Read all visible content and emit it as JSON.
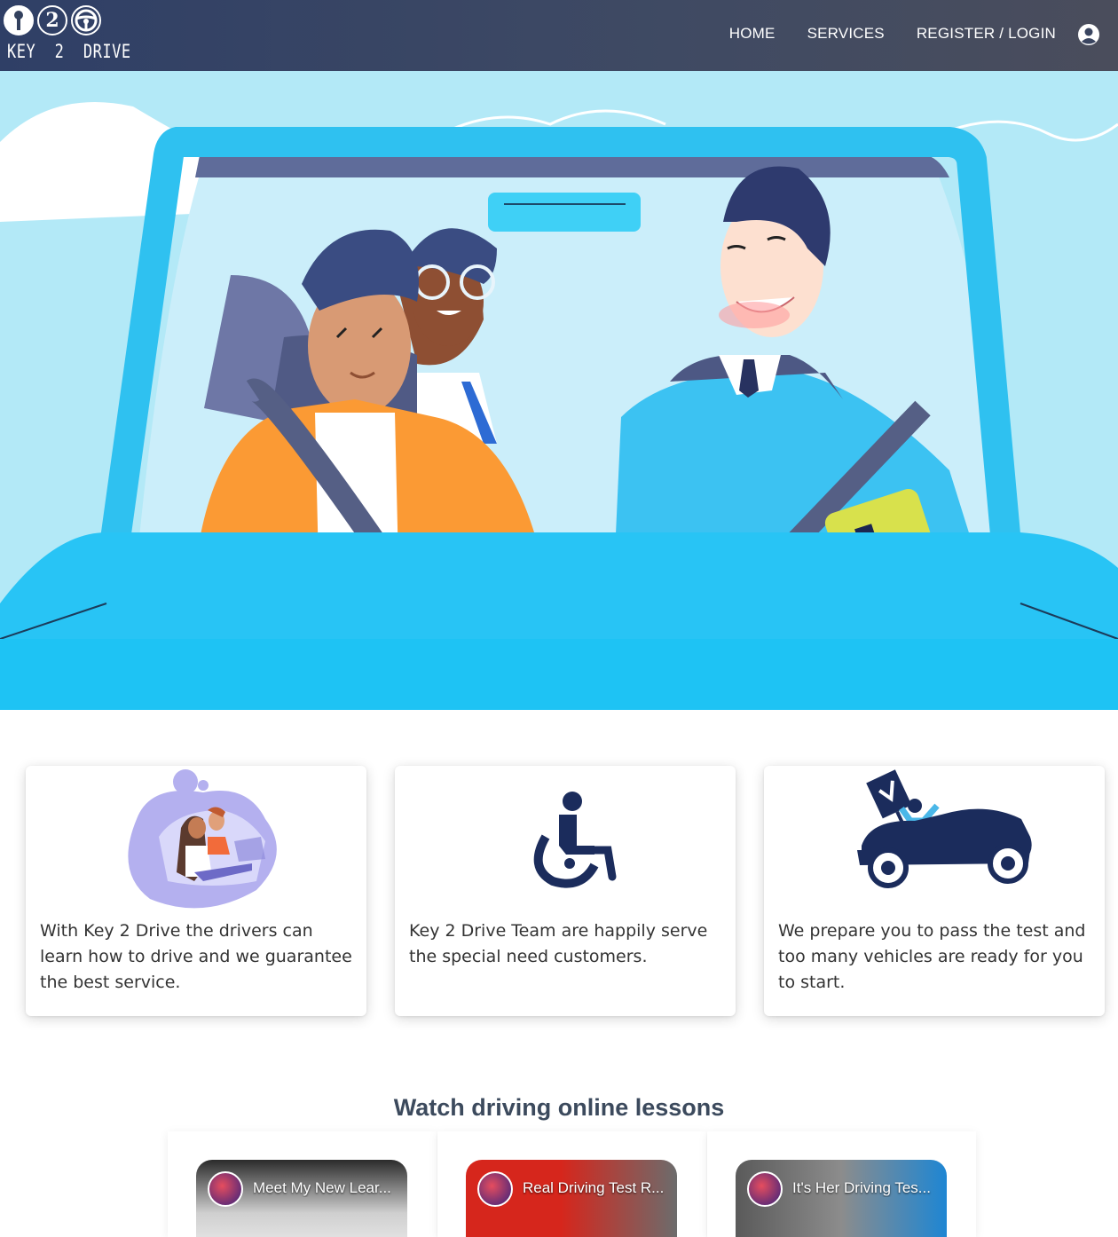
{
  "header": {
    "logo_text": "KEY  2  DRIVE",
    "logo_number": "2",
    "nav": [
      "HOME",
      "SERVICES",
      "REGISTER / LOGIN"
    ],
    "user_icon": "user-circle-icon"
  },
  "hero": {
    "illustration": "learner-driver-with-instructor-car-illustration",
    "colors": {
      "sky": "#b3e9f7",
      "car": "#29c6f5",
      "bg": "#1ec3f4"
    }
  },
  "features": [
    {
      "icon": "learner-couple-driving-illustration",
      "text": "With Key 2 Drive the drivers can learn how to drive and we guarantee the best service."
    },
    {
      "icon": "wheelchair-accessibility-icon",
      "text": "Key 2 Drive Team are happily serve the special need customers."
    },
    {
      "icon": "car-with-checkmark-sign-illustration",
      "text": "We prepare you to pass the test and too many vehicles are ready for you to start."
    }
  ],
  "lessons": {
    "title": "Watch driving online lessons",
    "videos": [
      {
        "title": "Meet My New Lear..."
      },
      {
        "title": "Real Driving Test R..."
      },
      {
        "title": "It's Her Driving Tes..."
      }
    ]
  },
  "colors": {
    "navbar": "#33415e",
    "accent_dark": "#1b2c5c",
    "text": "#333333"
  }
}
